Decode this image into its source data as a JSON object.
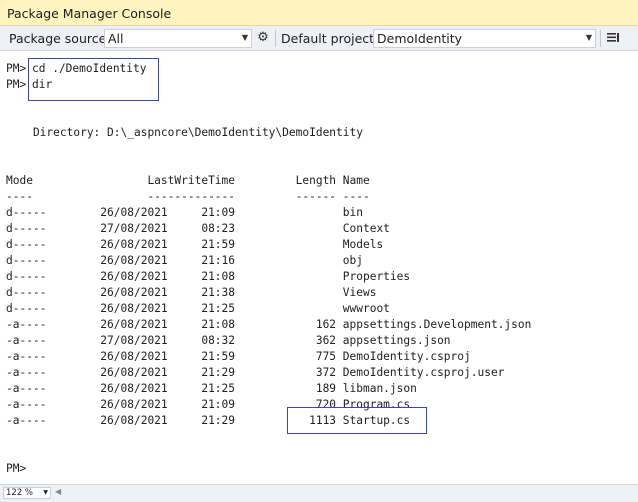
{
  "window": {
    "title": "Package Manager Console"
  },
  "toolbar": {
    "package_source_label": "Package source:",
    "package_source_value": "All",
    "default_project_label": "Default project:",
    "default_project_value": "DemoIdentity",
    "settings_icon": "gear-icon",
    "clear_icon": "clear-list-icon"
  },
  "console": {
    "prompt": "PM>",
    "commands": [
      "cd ./DemoIdentity",
      "dir"
    ],
    "directory_line": "    Directory: D:\\_aspncore\\DemoIdentity\\DemoIdentity",
    "header": "Mode                 LastWriteTime         Length Name",
    "header_rule": "----                 -------------         ------ ----",
    "rows": [
      "d-----        26/08/2021     21:09                bin",
      "d-----        27/08/2021     08:23                Context",
      "d-----        26/08/2021     21:59                Models",
      "d-----        26/08/2021     21:16                obj",
      "d-----        26/08/2021     21:08                Properties",
      "d-----        26/08/2021     21:38                Views",
      "d-----        26/08/2021     21:25                wwwroot",
      "-a----        26/08/2021     21:08            162 appsettings.Development.json",
      "-a----        27/08/2021     08:32            362 appsettings.json",
      "-a----        26/08/2021     21:59            775 DemoIdentity.csproj",
      "-a----        26/08/2021     21:29            372 DemoIdentity.csproj.user",
      "-a----        26/08/2021     21:25            189 libman.json",
      "-a----        26/08/2021     21:09            720 Program.cs",
      "-a----        26/08/2021     21:29           1113 Startup.cs"
    ],
    "final_prompt": "PM>"
  },
  "status": {
    "zoom": "122 %"
  },
  "colors": {
    "title_bg": "#fdf4bf",
    "toolbar_bg": "#eef0f5",
    "highlight_box": "#3b48a6"
  }
}
